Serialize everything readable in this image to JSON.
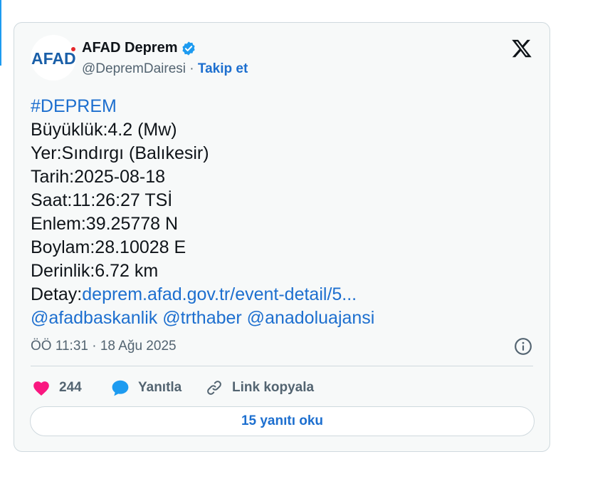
{
  "author": {
    "name": "AFAD Deprem",
    "handle": "@DepremDairesi",
    "separator": "·",
    "follow_label": "Takip et",
    "avatar_text": "AFAD"
  },
  "tweet": {
    "hashtag": "#DEPREM",
    "lines": [
      "Büyüklük:4.2 (Mw)",
      "Yer:Sındırgı (Balıkesir)",
      "Tarih:2025-08-18",
      "Saat:11:26:27 TSİ",
      "Enlem:39.25778 N",
      "Boylam:28.10028 E",
      "Derinlik:6.72 km"
    ],
    "detail_label": "Detay:",
    "detail_link": "deprem.afad.gov.tr/event-detail/5...",
    "mentions": "@afadbaskanlik @trthaber @anadoluajansi",
    "timestamp": "ÖÖ 11:31 · 18 Ağu 2025"
  },
  "actions": {
    "like_count": "244",
    "reply_label": "Yanıtla",
    "copy_link_label": "Link kopyala",
    "read_replies_label": "15 yanıtı oku"
  },
  "colors": {
    "accent": "#1d9bf0",
    "link": "#1d6fcf",
    "like": "#f91880",
    "brand_blue": "#1a5fa8",
    "brand_red": "#e5262a"
  },
  "icons": {
    "verified": "verified-badge-icon",
    "x_logo": "x-logo-icon",
    "info": "info-icon",
    "like": "heart-icon",
    "reply": "speech-bubble-icon",
    "copy_link": "link-icon"
  }
}
